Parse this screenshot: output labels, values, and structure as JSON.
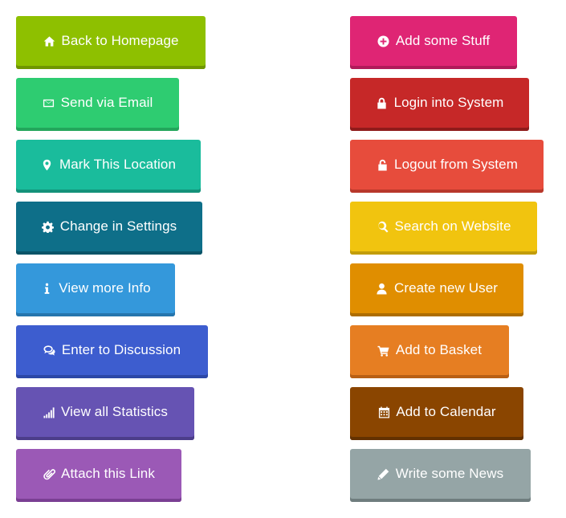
{
  "left_buttons": [
    {
      "label": "Back to Homepage",
      "icon": "home-icon",
      "color": "#8ec000",
      "shadow": "#6f9600",
      "width": 236
    },
    {
      "label": "Send via Email",
      "icon": "envelope-icon",
      "color": "#2ecc71",
      "shadow": "#23a65b",
      "width": 203
    },
    {
      "label": "Mark This Location",
      "icon": "map-marker-icon",
      "color": "#1abc9c",
      "shadow": "#14927a",
      "width": 230
    },
    {
      "label": "Change in Settings",
      "icon": "gear-icon",
      "color": "#0e6f89",
      "shadow": "#0a5468",
      "width": 232
    },
    {
      "label": "View more Info",
      "icon": "info-icon",
      "color": "#3498db",
      "shadow": "#2575ad",
      "width": 198
    },
    {
      "label": "Enter to Discussion",
      "icon": "comments-icon",
      "color": "#3d5dcf",
      "shadow": "#2c47a6",
      "width": 239
    },
    {
      "label": "View all Statistics",
      "icon": "signal-icon",
      "color": "#6653b3",
      "shadow": "#4c3d8a",
      "width": 222
    },
    {
      "label": "Attach this Link",
      "icon": "paperclip-icon",
      "color": "#9b59b6",
      "shadow": "#7a3f93",
      "width": 206
    }
  ],
  "right_buttons": [
    {
      "label": "Add some Stuff",
      "icon": "plus-circle-icon",
      "color": "#df2574",
      "shadow": "#b01a5a",
      "width": 208
    },
    {
      "label": "Login into System",
      "icon": "lock-icon",
      "color": "#c62828",
      "shadow": "#8f1b1b",
      "width": 223
    },
    {
      "label": "Logout from System",
      "icon": "unlock-icon",
      "color": "#e74c3c",
      "shadow": "#b8382b",
      "width": 241
    },
    {
      "label": "Search on Website",
      "icon": "search-icon",
      "color": "#f1c40f",
      "shadow": "#c29d0a",
      "width": 233
    },
    {
      "label": "Create new User",
      "icon": "user-icon",
      "color": "#e08e00",
      "shadow": "#ad6d00",
      "width": 216
    },
    {
      "label": "Add to Basket",
      "icon": "cart-icon",
      "color": "#e67e22",
      "shadow": "#b85f14",
      "width": 198
    },
    {
      "label": "Add to Calendar",
      "icon": "calendar-icon",
      "color": "#8a4500",
      "shadow": "#633100",
      "width": 216
    },
    {
      "label": "Write some News",
      "icon": "pencil-icon",
      "color": "#95a5a6",
      "shadow": "#6f7d7e",
      "width": 225
    }
  ]
}
